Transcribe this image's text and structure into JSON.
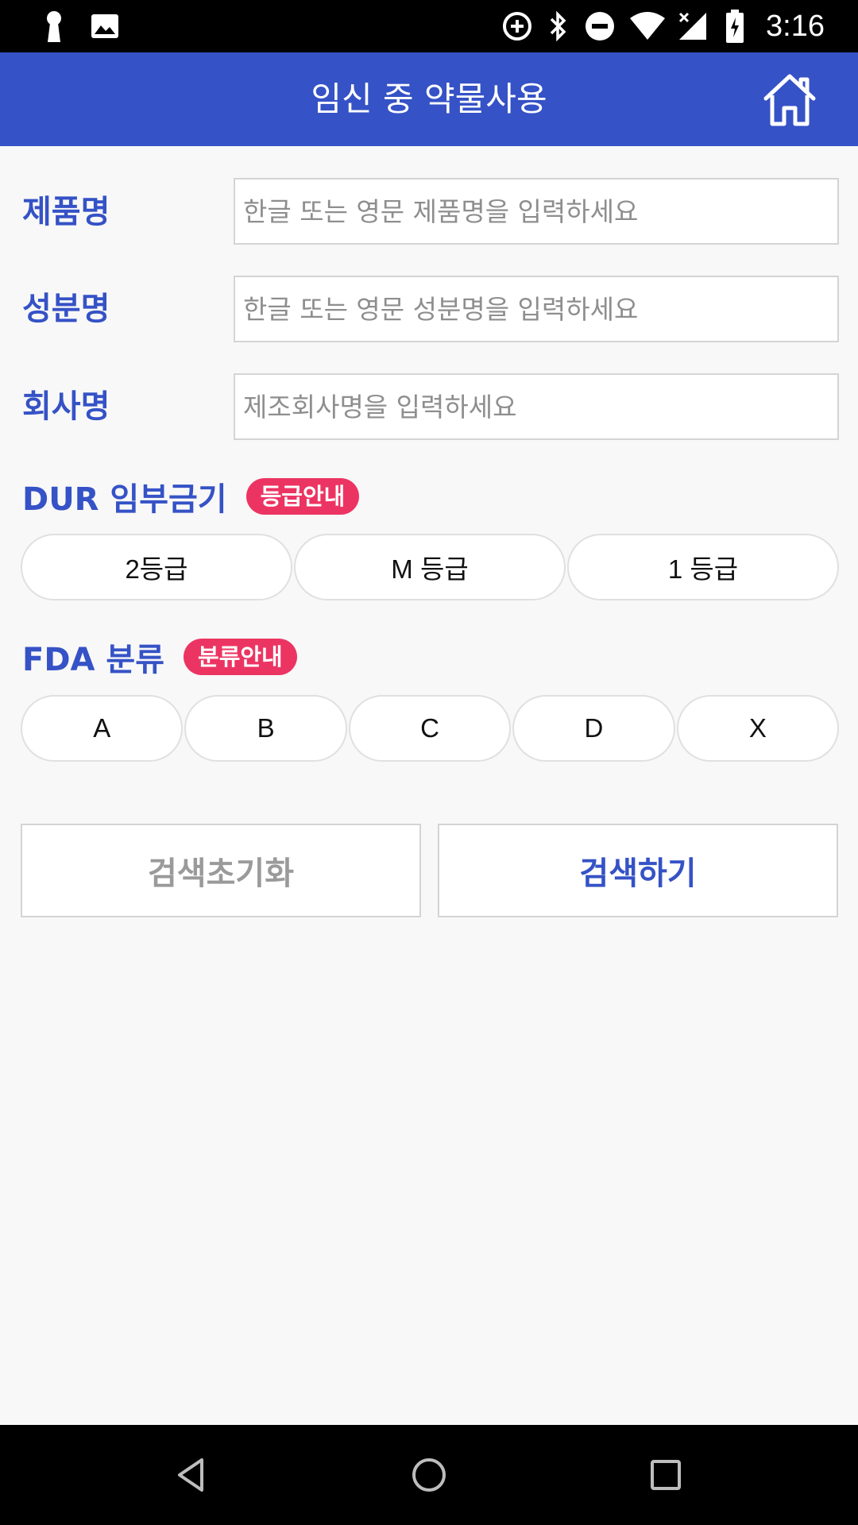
{
  "status_bar": {
    "time": "3:16",
    "icons": [
      "keyhole-icon",
      "image-icon",
      "data-saver-icon",
      "bluetooth-icon",
      "do-not-disturb-icon",
      "wifi-icon",
      "signal-icon",
      "battery-icon"
    ]
  },
  "app_bar": {
    "title": "임신 중 약물사용",
    "home_icon": "home-icon"
  },
  "form": {
    "product": {
      "label": "제품명",
      "placeholder": "한글 또는 영문 제품명을 입력하세요",
      "value": ""
    },
    "ingredient": {
      "label": "성분명",
      "placeholder": "한글 또는 영문 성분명을 입력하세요",
      "value": ""
    },
    "company": {
      "label": "회사명",
      "placeholder": "제조회사명을 입력하세요",
      "value": ""
    }
  },
  "dur": {
    "title": "DUR 임부금기",
    "badge": "등급안내",
    "options": [
      "2등급",
      "M 등급",
      "1 등급"
    ]
  },
  "fda": {
    "title": "FDA 분류",
    "badge": "분류안내",
    "options": [
      "A",
      "B",
      "C",
      "D",
      "X"
    ]
  },
  "actions": {
    "reset_label": "검색초기화",
    "search_label": "검색하기"
  },
  "colors": {
    "primary": "#3552c6",
    "badge": "#ec3462",
    "background": "#f8f8f8"
  },
  "nav_bar": {
    "icons": [
      "back-icon",
      "home-circle-icon",
      "recents-icon"
    ]
  }
}
